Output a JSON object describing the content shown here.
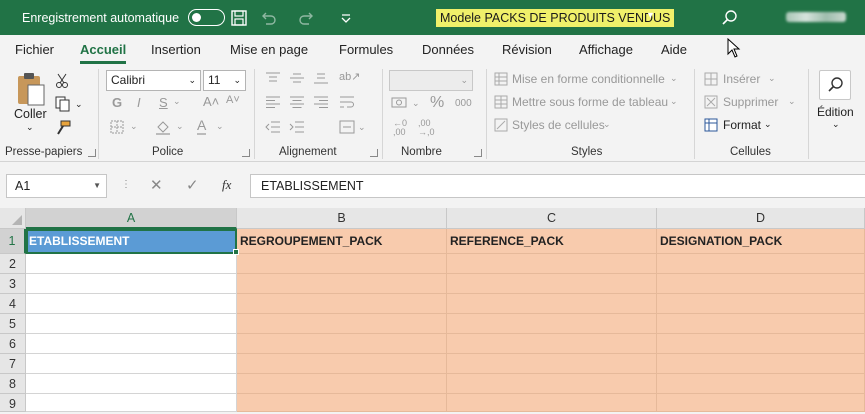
{
  "titlebar": {
    "autosave_label": "Enregistrement automatique",
    "document_title": "Modele PACKS DE PRODUITS VENDUS",
    "icons": [
      "save-icon",
      "undo-icon",
      "redo-icon",
      "customize-icon",
      "search-icon"
    ]
  },
  "tabs": [
    "Fichier",
    "Accueil",
    "Insertion",
    "Mise en page",
    "Formules",
    "Données",
    "Révision",
    "Affichage",
    "Aide"
  ],
  "active_tab": "Accueil",
  "ribbon": {
    "clipboard": {
      "paste_label": "Coller",
      "group_label": "Presse-papiers"
    },
    "font": {
      "font_name": "Calibri",
      "font_size": "11",
      "group_label": "Police",
      "bold": "G",
      "italic": "I",
      "underline": "S"
    },
    "alignment": {
      "group_label": "Alignement"
    },
    "number": {
      "group_label": "Nombre",
      "percent": "%",
      "thousands": "000"
    },
    "styles": {
      "conditional": "Mise en forme conditionnelle",
      "table": "Mettre sous forme de tableau",
      "cell_styles": "Styles de cellules",
      "group_label": "Styles"
    },
    "cells": {
      "insert": "Insérer",
      "delete": "Supprimer",
      "format": "Format",
      "group_label": "Cellules"
    },
    "editing": {
      "label": "Édition"
    }
  },
  "formula_bar": {
    "name_box": "A1",
    "fx": "fx",
    "content": "ETABLISSEMENT"
  },
  "sheet": {
    "columns": [
      "A",
      "B",
      "C",
      "D"
    ],
    "rows": [
      "1",
      "2",
      "3",
      "4",
      "5",
      "6",
      "7",
      "8",
      "9"
    ],
    "header_row": [
      "ETABLISSEMENT",
      "REGROUPEMENT_PACK",
      "REFERENCE_PACK",
      "DESIGNATION_PACK"
    ],
    "colors": {
      "selected_cell": "#5b9bd5",
      "peach_fill": "#f8cbad",
      "accent": "#217346"
    }
  }
}
